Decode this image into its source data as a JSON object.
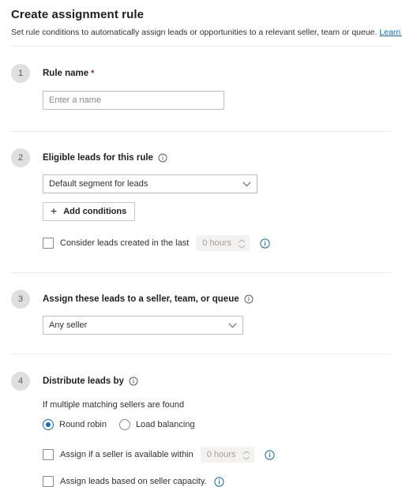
{
  "header": {
    "title": "Create assignment rule",
    "subtitle": "Set rule conditions to automatically assign leads or opportunities to a relevant seller, team or queue.",
    "learn_more_label": "Learn more"
  },
  "colors": {
    "accent_blue": "#0f6cbd",
    "required_red": "#a4262c",
    "badge_gray": "#e1dfdd",
    "divider": "#edebe9",
    "disabled_field": "#f3f2f1"
  },
  "steps": [
    {
      "number": "1",
      "title": "Rule name",
      "required": true,
      "has_info": false,
      "rule_name_input": {
        "value": "",
        "placeholder": "Enter a name"
      }
    },
    {
      "number": "2",
      "title": "Eligible leads for this rule",
      "required": false,
      "has_info": true,
      "segment_select": {
        "selected": "Default segment for leads",
        "options": [
          "Default segment for leads"
        ]
      },
      "add_conditions_button": "Add conditions",
      "consider_checkbox": {
        "label": "Consider leads created in the last",
        "checked": false,
        "spinner_value": "0 hours",
        "spinner_disabled": true,
        "info": "info-icon"
      }
    },
    {
      "number": "3",
      "title": "Assign these leads to a seller, team, or queue",
      "required": false,
      "has_info": true,
      "assignee_select": {
        "selected": "Any seller",
        "options": [
          "Any seller"
        ]
      }
    },
    {
      "number": "4",
      "title": "Distribute leads by",
      "required": false,
      "has_info": true,
      "note": "If multiple matching sellers are found",
      "radios": [
        {
          "label": "Round robin",
          "checked": true
        },
        {
          "label": "Load balancing",
          "checked": false
        }
      ],
      "availability_checkbox": {
        "label": "Assign if a seller is available within",
        "checked": false,
        "spinner_value": "0 hours",
        "spinner_disabled": true,
        "info": "info-icon"
      },
      "capacity_checkbox": {
        "label": "Assign leads based on seller capacity.",
        "checked": false,
        "info": "info-icon"
      }
    }
  ]
}
